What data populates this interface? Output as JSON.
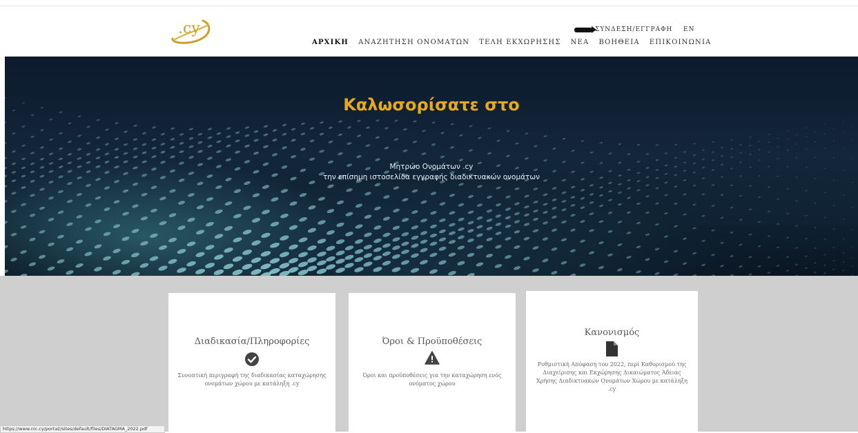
{
  "header": {
    "logo_text": ".cy",
    "login": "ΣΥΝΔΕΣΗ/ΕΓΓΡΑΦΗ",
    "lang": "EN",
    "nav": [
      {
        "label": "ΑΡΧΙΚΗ",
        "active": true
      },
      {
        "label": "ΑΝΑΖΗΤΗΣΗ ΟΝΟΜΑΤΩΝ",
        "active": false
      },
      {
        "label": "ΤΕΛΗ ΕΚΧΩΡΗΣΗΣ",
        "active": false
      },
      {
        "label": "ΝΕΑ",
        "active": false
      },
      {
        "label": "ΒΟΗΘΕΙΑ",
        "active": false
      },
      {
        "label": "ΕΠΙΚΟΙΝΩΝΙΑ",
        "active": false
      }
    ]
  },
  "hero": {
    "title": "Καλωσορίσατε στο",
    "line1": "Μητρώο Ονομάτων .cy",
    "line2": "την επίσημη ιστοσελίδα εγγραφής διαδικτυακών ονομάτων",
    "accent": "#e8a81c"
  },
  "cards": [
    {
      "title": "Διαδικασία/Πληροφορίες",
      "icon": "check-circle-icon",
      "desc": "Συνοπτική περιγραφή της διαδικασίας καταχώρησης ονομάτων χώρου με κατάληξη .cy"
    },
    {
      "title": "Όροι & Προϋποθέσεις",
      "icon": "warning-icon",
      "desc": "Όροι και προϋποθέσεις για την καταχώρηση ενός ονόματος χώρου"
    },
    {
      "title": "Κανονισμός",
      "icon": "document-icon",
      "desc": "Ρυθμιστική Απόφαση του 2022, περί Καθορισμού της Διαχείρισης και Εκχώρησης Δικαιώματος Άδειας Χρήσης Διαδικτυακών Ονομάτων Χώρου με κατάληξη .cy"
    }
  ],
  "status_url": "https://www.nic.cy/portal//sites/default/files/DIATAGMA_2022.pdf"
}
